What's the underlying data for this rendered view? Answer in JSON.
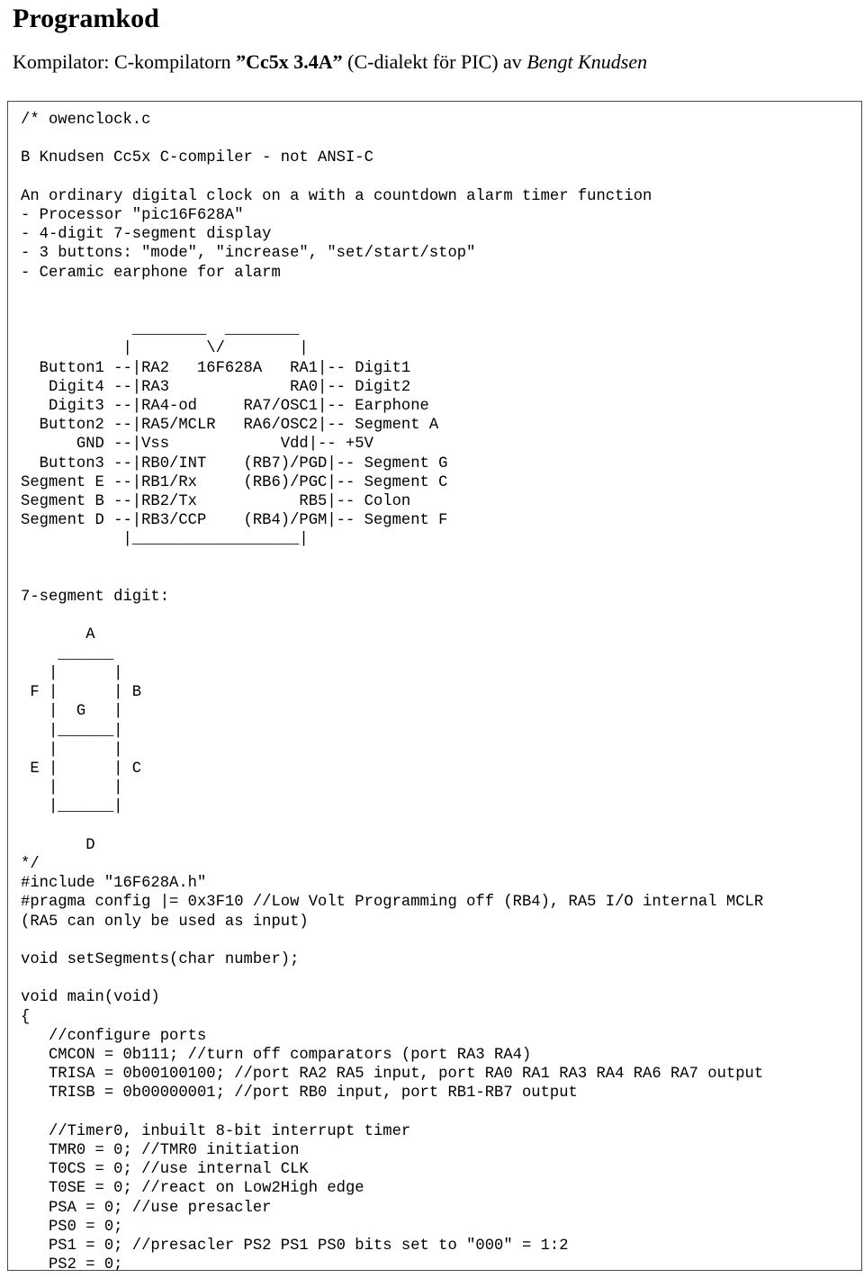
{
  "document": {
    "title": "Programkod",
    "subtitle": {
      "prefix": "Kompilator: C-kompilatorn ",
      "compiler_quoted": "”Cc5x 3.4A”",
      "middle": " (C-dialekt för PIC) av ",
      "author": "Bengt Knudsen"
    }
  },
  "code_block": {
    "language": "c",
    "filename": "owenclock.c",
    "processor": "pic16F628A",
    "header_comment": {
      "open": "/* owenclock.c",
      "compiler_line": "B Knudsen Cc5x C-compiler - not ANSI-C",
      "description": "An ordinary digital clock on a with a countdown alarm timer function",
      "bullets": [
        "- Processor \"pic16F628A\"",
        "- 4-digit 7-segment display",
        "- 3 buttons: \"mode\", \"increase\", \"set/start/stop\"",
        "- Ceramic earphone for alarm"
      ],
      "close": "*/"
    },
    "pinout_diagram": {
      "chip_label": "16F628A",
      "pins_left": [
        {
          "signal": "Button1",
          "pin": "RA2"
        },
        {
          "signal": "Digit4",
          "pin": "RA3"
        },
        {
          "signal": "Digit3",
          "pin": "RA4-od"
        },
        {
          "signal": "Button2",
          "pin": "RA5/MCLR"
        },
        {
          "signal": "GND",
          "pin": "Vss"
        },
        {
          "signal": "Button3",
          "pin": "RB0/INT"
        },
        {
          "signal": "Segment E",
          "pin": "RB1/Rx"
        },
        {
          "signal": "Segment B",
          "pin": "RB2/Tx"
        },
        {
          "signal": "Segment D",
          "pin": "RB3/CCP"
        }
      ],
      "pins_right": [
        {
          "pin": "RA1",
          "signal": "Digit1"
        },
        {
          "pin": "RA0",
          "signal": "Digit2"
        },
        {
          "pin": "RA7/OSC1",
          "signal": "Earphone"
        },
        {
          "pin": "RA6/OSC2",
          "signal": "Segment A"
        },
        {
          "pin": "Vdd",
          "signal": "+5V"
        },
        {
          "pin": "(RB7)/PGD",
          "signal": "Segment G"
        },
        {
          "pin": "(RB6)/PGC",
          "signal": "Segment C"
        },
        {
          "pin": "RB5",
          "signal": "Colon"
        },
        {
          "pin": "(RB4)/PGM",
          "signal": "Segment F"
        }
      ]
    },
    "segment_diagram": {
      "caption": "7-segment digit:",
      "labels": [
        "A",
        "B",
        "C",
        "D",
        "E",
        "F",
        "G"
      ]
    },
    "directives": [
      "#include \"16F628A.h\"",
      "#pragma config |= 0x3F10 //Low Volt Programming off (RB4), RA5 I/O internal MCLR",
      "(RA5 can only be used as input)"
    ],
    "prototype": "void setSegments(char number);",
    "main_signature": "void main(void)",
    "open_brace": "{",
    "port_config": {
      "comment": "//configure ports",
      "lines": [
        "CMCON = 0b111; //turn off comparators (port RA3 RA4)",
        "TRISA = 0b00100100; //port RA2 RA5 input, port RA0 RA1 RA3 RA4 RA6 RA7 output",
        "TRISB = 0b00000001; //port RB0 input, port RB1-RB7 output"
      ]
    },
    "timer_config": {
      "comment": "//Timer0, inbuilt 8-bit interrupt timer",
      "lines": [
        "TMR0 = 0; //TMR0 initiation",
        "T0CS = 0; //use internal CLK",
        "T0SE = 0; //react on Low2High edge",
        "PSA = 0; //use presacler",
        "PS0 = 0;",
        "PS1 = 0; //presacler PS2 PS1 PS0 bits set to \"000\" = 1:2",
        "PS2 = 0;"
      ]
    },
    "full_text": "/* owenclock.c\n\nB Knudsen Cc5x C-compiler - not ANSI-C\n\nAn ordinary digital clock on a with a countdown alarm timer function\n- Processor \"pic16F628A\"\n- 4-digit 7-segment display\n- 3 buttons: \"mode\", \"increase\", \"set/start/stop\"\n- Ceramic earphone for alarm\n\n\n            ________  ________\n           |        \\/        |\n  Button1 --|RA2   16F628A   RA1|-- Digit1\n   Digit4 --|RA3             RA0|-- Digit2\n   Digit3 --|RA4-od     RA7/OSC1|-- Earphone\n  Button2 --|RA5/MCLR   RA6/OSC2|-- Segment A\n      GND --|Vss            Vdd|-- +5V\n  Button3 --|RB0/INT    (RB7)/PGD|-- Segment G\nSegment E --|RB1/Rx     (RB6)/PGC|-- Segment C\nSegment B --|RB2/Tx           RB5|-- Colon\nSegment D --|RB3/CCP    (RB4)/PGM|-- Segment F\n           |__________________|\n\n\n7-segment digit:\n\n       A\n    ______\n   |      |\n F |      | B\n   |  G   |\n   |______|\n   |      |\n E |      | C\n   |      |\n   |______|\n\n       D\n*/\n#include \"16F628A.h\"\n#pragma config |= 0x3F10 //Low Volt Programming off (RB4), RA5 I/O internal MCLR\n(RA5 can only be used as input)\n\nvoid setSegments(char number);\n\nvoid main(void)\n{\n   //configure ports\n   CMCON = 0b111; //turn off comparators (port RA3 RA4)\n   TRISA = 0b00100100; //port RA2 RA5 input, port RA0 RA1 RA3 RA4 RA6 RA7 output\n   TRISB = 0b00000001; //port RB0 input, port RB1-RB7 output\n\n   //Timer0, inbuilt 8-bit interrupt timer\n   TMR0 = 0; //TMR0 initiation\n   T0CS = 0; //use internal CLK\n   T0SE = 0; //react on Low2High edge\n   PSA = 0; //use presacler\n   PS0 = 0;\n   PS1 = 0; //presacler PS2 PS1 PS0 bits set to \"000\" = 1:2\n   PS2 = 0;"
  }
}
